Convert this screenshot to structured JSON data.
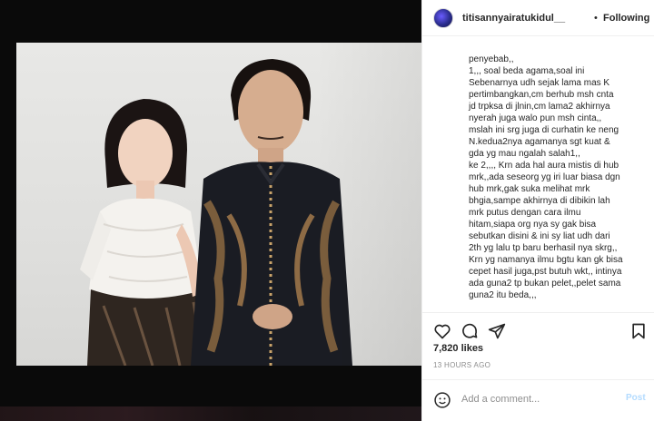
{
  "header": {
    "username": "titisannyairatukidul__",
    "separator": "•",
    "follow_status": "Following"
  },
  "caption": {
    "lines": [
      "penyebab,,",
      "1,,, soal beda agama,soal ini",
      "Sebenarnya udh sejak lama mas K",
      "pertimbangkan,cm berhub msh cnta",
      "jd trpksa di jlnin,cm lama2 akhirnya",
      "nyerah juga walo pun msh cinta,,",
      "mslah ini srg juga di curhatin ke neng",
      "N.kedua2nya agamanya sgt kuat &",
      "gda yg mau ngalah salah1,,",
      "ke 2,,,, Krn ada hal aura mistis di hub",
      "mrk,,ada seseorg yg iri luar biasa dgn",
      "hub mrk,gak suka melihat mrk",
      "bhgia,sampe akhirnya di dibikin lah",
      "mrk putus dengan cara ilmu",
      "hitam,siapa org nya sy gak bisa",
      "sebutkan disini & ini sy liat udh dari",
      "2th yg lalu tp baru berhasil nya skrg,,",
      "Krn yg namanya ilmu bgtu kan gk bisa",
      "cepet hasil juga,pst butuh wkt,, intinya",
      "ada guna2 tp bukan pelet,,pelet sama",
      "guna2 itu beda,,,"
    ]
  },
  "stats": {
    "likes": "7,820 likes",
    "timestamp": "13 HOURS AGO"
  },
  "comment": {
    "placeholder": "Add a comment...",
    "post_label": "Post"
  },
  "icons": {
    "like": "heart-icon",
    "comment": "comment-bubble-icon",
    "share": "paper-plane-icon",
    "save": "bookmark-icon",
    "emoji": "smiley-icon"
  }
}
